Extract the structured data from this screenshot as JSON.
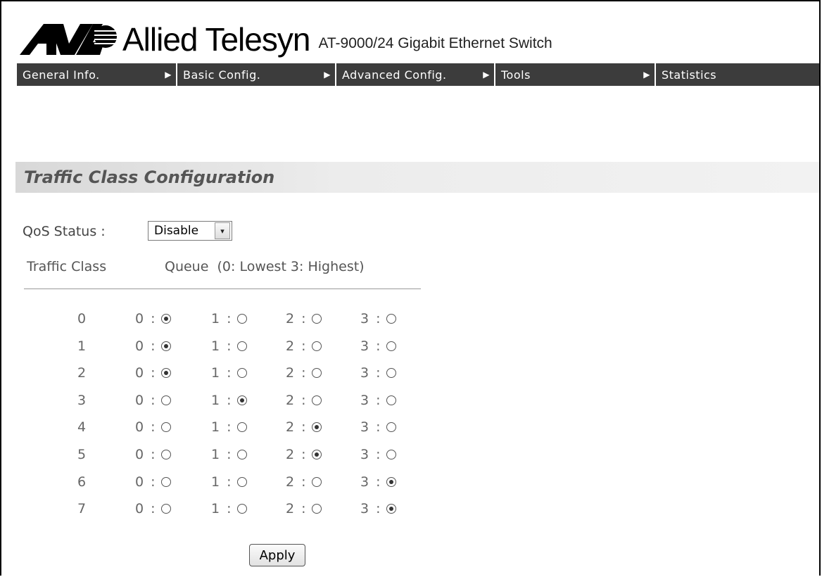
{
  "brand": {
    "logo_icon": "allied-telesyn-logo-icon",
    "name": "Allied Telesyn",
    "product": "AT-9000/24 Gigabit Ethernet Switch"
  },
  "nav": [
    {
      "label": "General Info.",
      "arrow": "▶"
    },
    {
      "label": "Basic Config.",
      "arrow": "▶"
    },
    {
      "label": "Advanced Config.",
      "arrow": "▶"
    },
    {
      "label": "Tools",
      "arrow": "▶"
    },
    {
      "label": "Statistics",
      "arrow": ""
    }
  ],
  "section": {
    "title": "Traffic Class Configuration"
  },
  "qos": {
    "label": "QoS Status :",
    "value": "Disable",
    "dropdown_icon": "chevron-down-icon"
  },
  "table": {
    "col_class": "Traffic Class",
    "col_queue": "Queue  (0: Lowest 3: Highest)",
    "rows": [
      {
        "cls": "0",
        "q0": "0 :",
        "q1": "1 :",
        "q2": "2 :",
        "q3": "3 :",
        "selected": 0
      },
      {
        "cls": "1",
        "q0": "0 :",
        "q1": "1 :",
        "q2": "2 :",
        "q3": "3 :",
        "selected": 0
      },
      {
        "cls": "2",
        "q0": "0 :",
        "q1": "1 :",
        "q2": "2 :",
        "q3": "3 :",
        "selected": 0
      },
      {
        "cls": "3",
        "q0": "0 :",
        "q1": "1 :",
        "q2": "2 :",
        "q3": "3 :",
        "selected": 1
      },
      {
        "cls": "4",
        "q0": "0 :",
        "q1": "1 :",
        "q2": "2 :",
        "q3": "3 :",
        "selected": 2
      },
      {
        "cls": "5",
        "q0": "0 :",
        "q1": "1 :",
        "q2": "2 :",
        "q3": "3 :",
        "selected": 2
      },
      {
        "cls": "6",
        "q0": "0 :",
        "q1": "1 :",
        "q2": "2 :",
        "q3": "3 :",
        "selected": 3
      },
      {
        "cls": "7",
        "q0": "0 :",
        "q1": "1 :",
        "q2": "2 :",
        "q3": "3 :",
        "selected": 3
      }
    ]
  },
  "apply_label": "Apply"
}
